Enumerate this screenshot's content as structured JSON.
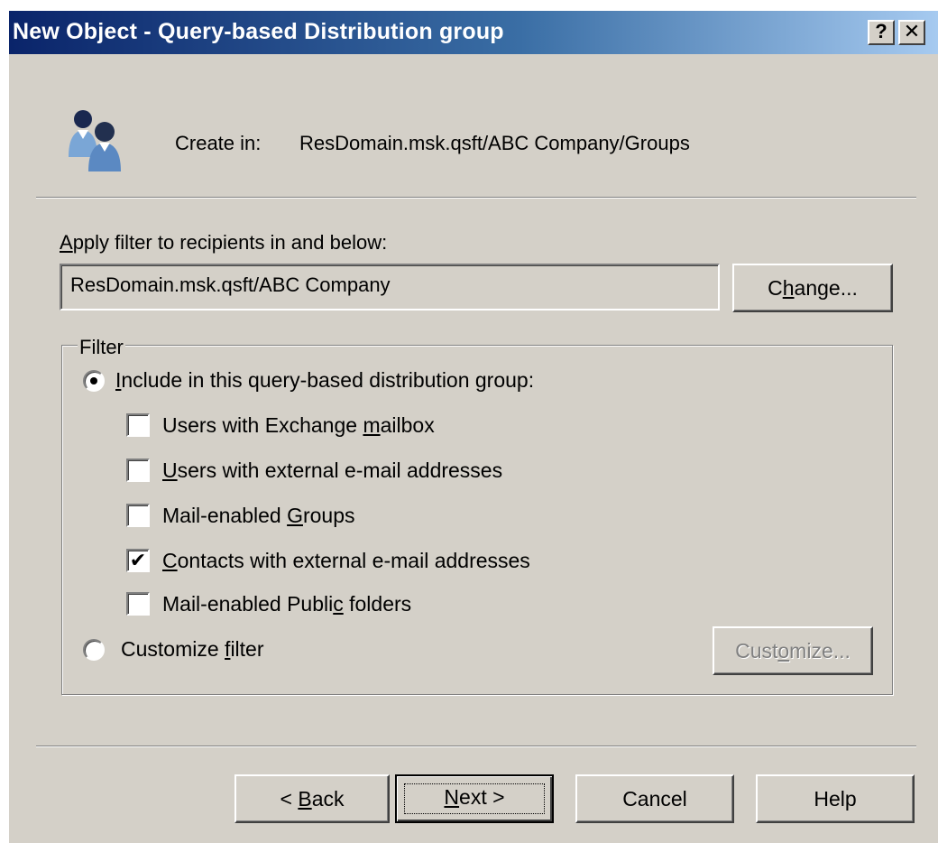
{
  "dialog": {
    "title": "New Object - Query-based Distribution group",
    "help_button": "?",
    "close_button": "✕"
  },
  "create_in": {
    "label": "Create in:",
    "path": "ResDomain.msk.qsft/ABC Company/Groups"
  },
  "apply_filter": {
    "label_prefix": "",
    "label_mnemonic": "A",
    "label_rest": "pply filter to recipients in and below:",
    "container": "ResDomain.msk.qsft/ABC Company",
    "change_pre": "C",
    "change_mn": "h",
    "change_post": "ange..."
  },
  "filter": {
    "group_label": "Filter",
    "include_option": {
      "mnemonic": "I",
      "rest": "nclude in this query-based distribution group:",
      "selected": true
    },
    "checkboxes": [
      {
        "pre": "Users with Exchange ",
        "mn": "m",
        "post": "ailbox",
        "checked": false
      },
      {
        "pre": "",
        "mn": "U",
        "post": "sers with external e-mail addresses",
        "checked": false
      },
      {
        "pre": "Mail-enabled ",
        "mn": "G",
        "post": "roups",
        "checked": true
      },
      {
        "pre": "",
        "mn": "C",
        "post": "ontacts with external e-mail addresses",
        "checked": true
      },
      {
        "pre": "Mail-enabled Publi",
        "mn": "c",
        "post": " folders",
        "checked": false
      }
    ],
    "customize_option": {
      "pre": "Customize ",
      "mn": "f",
      "post": "ilter",
      "selected": false
    },
    "customize_button": {
      "pre": "Cust",
      "mn": "o",
      "post": "mize...",
      "enabled": false
    }
  },
  "footer": {
    "back": {
      "pre": "< ",
      "mn": "B",
      "post": "ack"
    },
    "next": {
      "pre": "",
      "mn": "N",
      "post": "ext >"
    },
    "cancel": "Cancel",
    "help": "Help"
  }
}
